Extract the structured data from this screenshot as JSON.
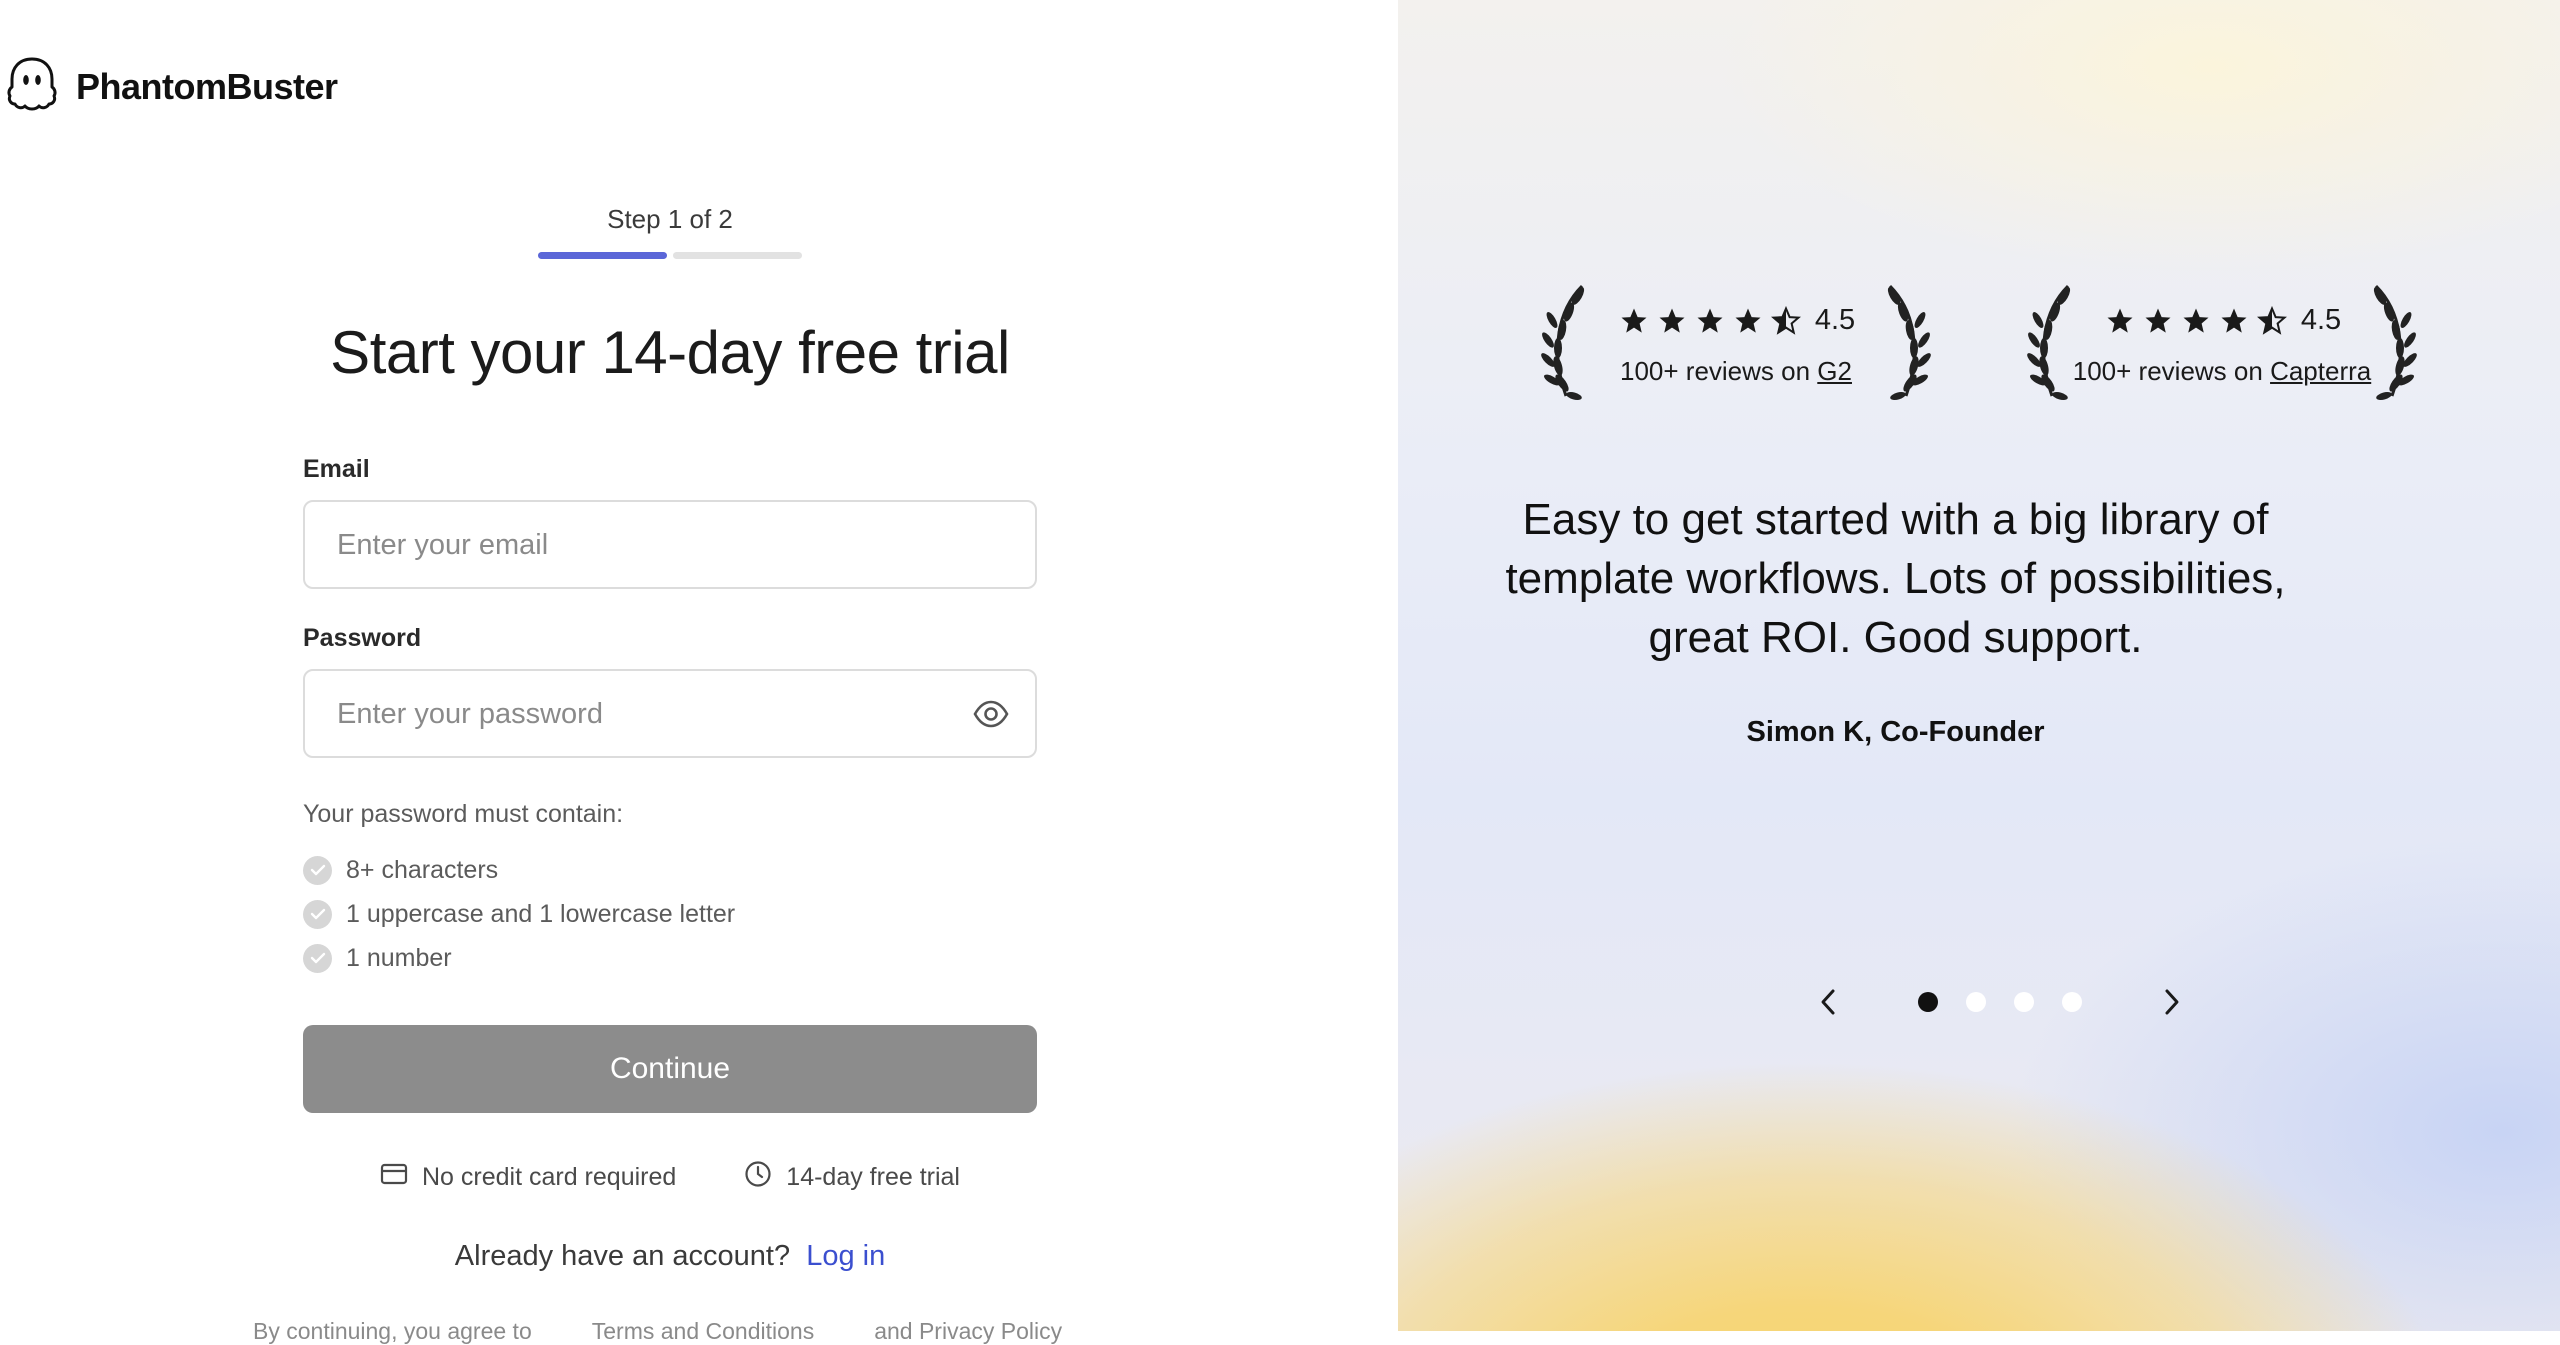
{
  "brand": {
    "name": "PhantomBuster"
  },
  "signup": {
    "step_label": "Step 1 of 2",
    "progress": {
      "current": 1,
      "total": 2
    },
    "title": "Start your 14-day free trial",
    "email": {
      "label": "Email",
      "placeholder": "Enter your email",
      "value": ""
    },
    "password": {
      "label": "Password",
      "placeholder": "Enter your password",
      "value": ""
    },
    "requirements_title": "Your password must contain:",
    "requirements": [
      {
        "label": "8+ characters",
        "met": false
      },
      {
        "label": "1 uppercase and 1 lowercase letter",
        "met": false
      },
      {
        "label": "1 number",
        "met": false
      }
    ],
    "continue_label": "Continue",
    "perks": [
      {
        "icon": "credit-card-icon",
        "label": "No credit card required"
      },
      {
        "icon": "clock-icon",
        "label": "14-day free trial"
      }
    ],
    "login_prompt": "Already have an account?",
    "login_link": "Log in",
    "footer": [
      "By continuing, you agree to",
      "Terms and Conditions",
      "and Privacy Policy"
    ]
  },
  "testimonials": {
    "badges": [
      {
        "rating": "4.5",
        "stars": 4.5,
        "reviews_prefix": "100+ reviews on",
        "platform": "G2"
      },
      {
        "rating": "4.5",
        "stars": 4.5,
        "reviews_prefix": "100+ reviews on",
        "platform": "Capterra"
      }
    ],
    "quote": "Easy to get started with a big library of template workflows. Lots of possibilities, great ROI. Good support.",
    "author": "Simon K, Co-Founder",
    "carousel": {
      "active_index": 0,
      "count": 4
    }
  },
  "colors": {
    "progress_active": "#5b67d8",
    "progress_inactive": "#e2e2e2",
    "button_disabled": "#8c8c8c",
    "link": "#3b4fcf"
  }
}
